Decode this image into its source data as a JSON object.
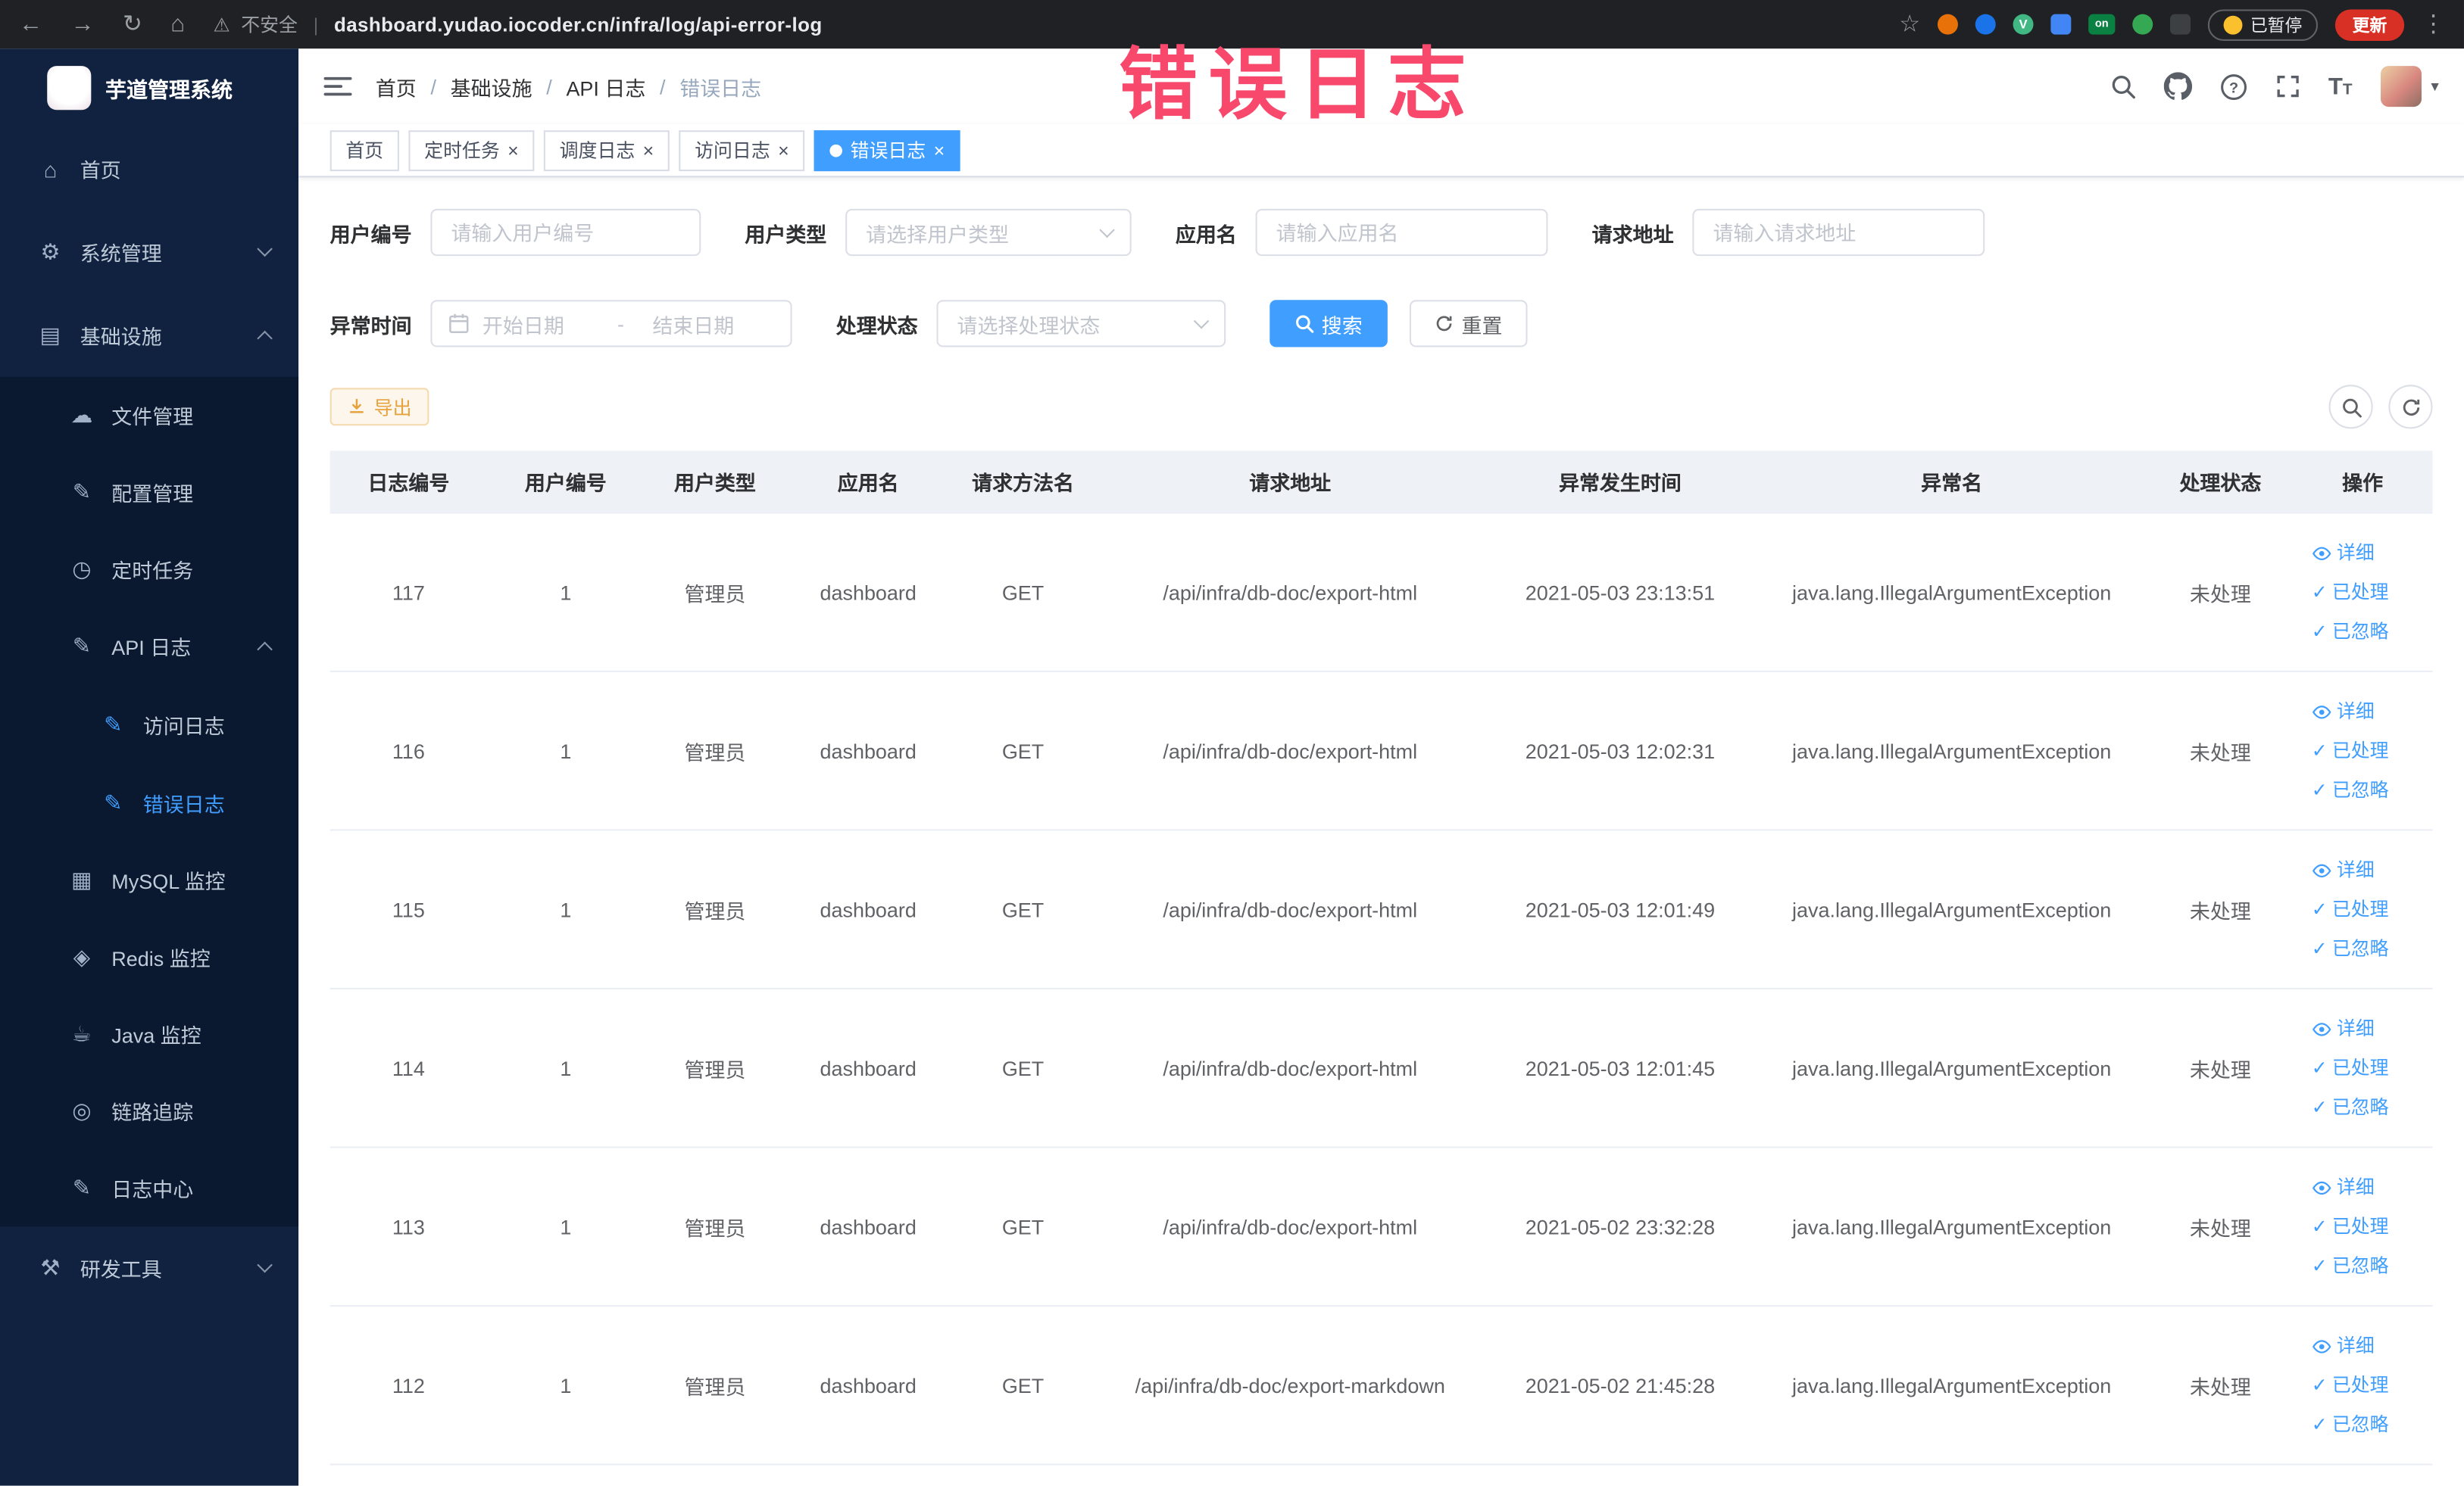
{
  "browser": {
    "security_label": "不安全",
    "url": "dashboard.yudao.iocoder.cn/infra/log/api-error-log",
    "paused_button": "已暂停",
    "update_button": "更新"
  },
  "icons": {
    "back": "←",
    "forward": "→",
    "reload": "↻",
    "home": "⌂",
    "warning": "⚠",
    "star": "☆",
    "kebab": "⋮",
    "extension_v": "V",
    "extension_on": "on",
    "close": "×",
    "caret_down": "▾",
    "check": "✓",
    "dash": "-",
    "font_size_big": "T",
    "font_size_small": "T"
  },
  "annotation": {
    "text": "错误日志"
  },
  "sidebar": {
    "title": "芋道管理系统",
    "items": [
      {
        "icon": "⌂",
        "label": "首页"
      },
      {
        "icon": "⚙",
        "label": "系统管理"
      },
      {
        "icon": "▤",
        "label": "基础设施"
      },
      {
        "icon": "☁",
        "label": "文件管理"
      },
      {
        "icon": "✎",
        "label": "配置管理"
      },
      {
        "icon": "◷",
        "label": "定时任务"
      },
      {
        "icon": "✎",
        "label": "API 日志"
      },
      {
        "icon": "✎",
        "label": "访问日志"
      },
      {
        "icon": "✎",
        "label": "错误日志"
      },
      {
        "icon": "▦",
        "label": "MySQL 监控"
      },
      {
        "icon": "◈",
        "label": "Redis 监控"
      },
      {
        "icon": "☕",
        "label": "Java 监控"
      },
      {
        "icon": "◎",
        "label": "链路追踪"
      },
      {
        "icon": "✎",
        "label": "日志中心"
      },
      {
        "icon": "⚒",
        "label": "研发工具"
      }
    ]
  },
  "breadcrumb": {
    "separator": "/",
    "items": [
      "首页",
      "基础设施",
      "API 日志",
      "错误日志"
    ]
  },
  "tabs": [
    {
      "label": "首页"
    },
    {
      "label": "定时任务"
    },
    {
      "label": "调度日志"
    },
    {
      "label": "访问日志"
    },
    {
      "label": "错误日志"
    }
  ],
  "filters": {
    "user_id_label": "用户编号",
    "user_id_placeholder": "请输入用户编号",
    "user_type_label": "用户类型",
    "user_type_placeholder": "请选择用户类型",
    "app_name_label": "应用名",
    "app_name_placeholder": "请输入应用名",
    "request_url_label": "请求地址",
    "request_url_placeholder": "请输入请求地址",
    "time_label": "异常时间",
    "time_start_placeholder": "开始日期",
    "time_end_placeholder": "结束日期",
    "status_label": "处理状态",
    "status_placeholder": "请选择处理状态",
    "search_button": "搜索",
    "reset_button": "重置"
  },
  "toolbar": {
    "export_button": "导出"
  },
  "table": {
    "columns": [
      "日志编号",
      "用户编号",
      "用户类型",
      "应用名",
      "请求方法名",
      "请求地址",
      "异常发生时间",
      "异常名",
      "处理状态",
      "操作"
    ],
    "action_labels": [
      "详细",
      "已处理",
      "已忽略"
    ],
    "rows": [
      {
        "id": "117",
        "user_id": "1",
        "user_type": "管理员",
        "app_name": "dashboard",
        "method": "GET",
        "url": "/api/infra/db-doc/export-html",
        "time": "2021-05-03 23:13:51",
        "exception": "java.lang.IllegalArgumentException",
        "status": "未处理"
      },
      {
        "id": "116",
        "user_id": "1",
        "user_type": "管理员",
        "app_name": "dashboard",
        "method": "GET",
        "url": "/api/infra/db-doc/export-html",
        "time": "2021-05-03 12:02:31",
        "exception": "java.lang.IllegalArgumentException",
        "status": "未处理"
      },
      {
        "id": "115",
        "user_id": "1",
        "user_type": "管理员",
        "app_name": "dashboard",
        "method": "GET",
        "url": "/api/infra/db-doc/export-html",
        "time": "2021-05-03 12:01:49",
        "exception": "java.lang.IllegalArgumentException",
        "status": "未处理"
      },
      {
        "id": "114",
        "user_id": "1",
        "user_type": "管理员",
        "app_name": "dashboard",
        "method": "GET",
        "url": "/api/infra/db-doc/export-html",
        "time": "2021-05-03 12:01:45",
        "exception": "java.lang.IllegalArgumentException",
        "status": "未处理"
      },
      {
        "id": "113",
        "user_id": "1",
        "user_type": "管理员",
        "app_name": "dashboard",
        "method": "GET",
        "url": "/api/infra/db-doc/export-html",
        "time": "2021-05-02 23:32:28",
        "exception": "java.lang.IllegalArgumentException",
        "status": "未处理"
      },
      {
        "id": "112",
        "user_id": "1",
        "user_type": "管理员",
        "app_name": "dashboard",
        "method": "GET",
        "url": "/api/infra/db-doc/export-markdown",
        "time": "2021-05-02 21:45:28",
        "exception": "java.lang.IllegalArgumentException",
        "status": "未处理"
      }
    ]
  }
}
